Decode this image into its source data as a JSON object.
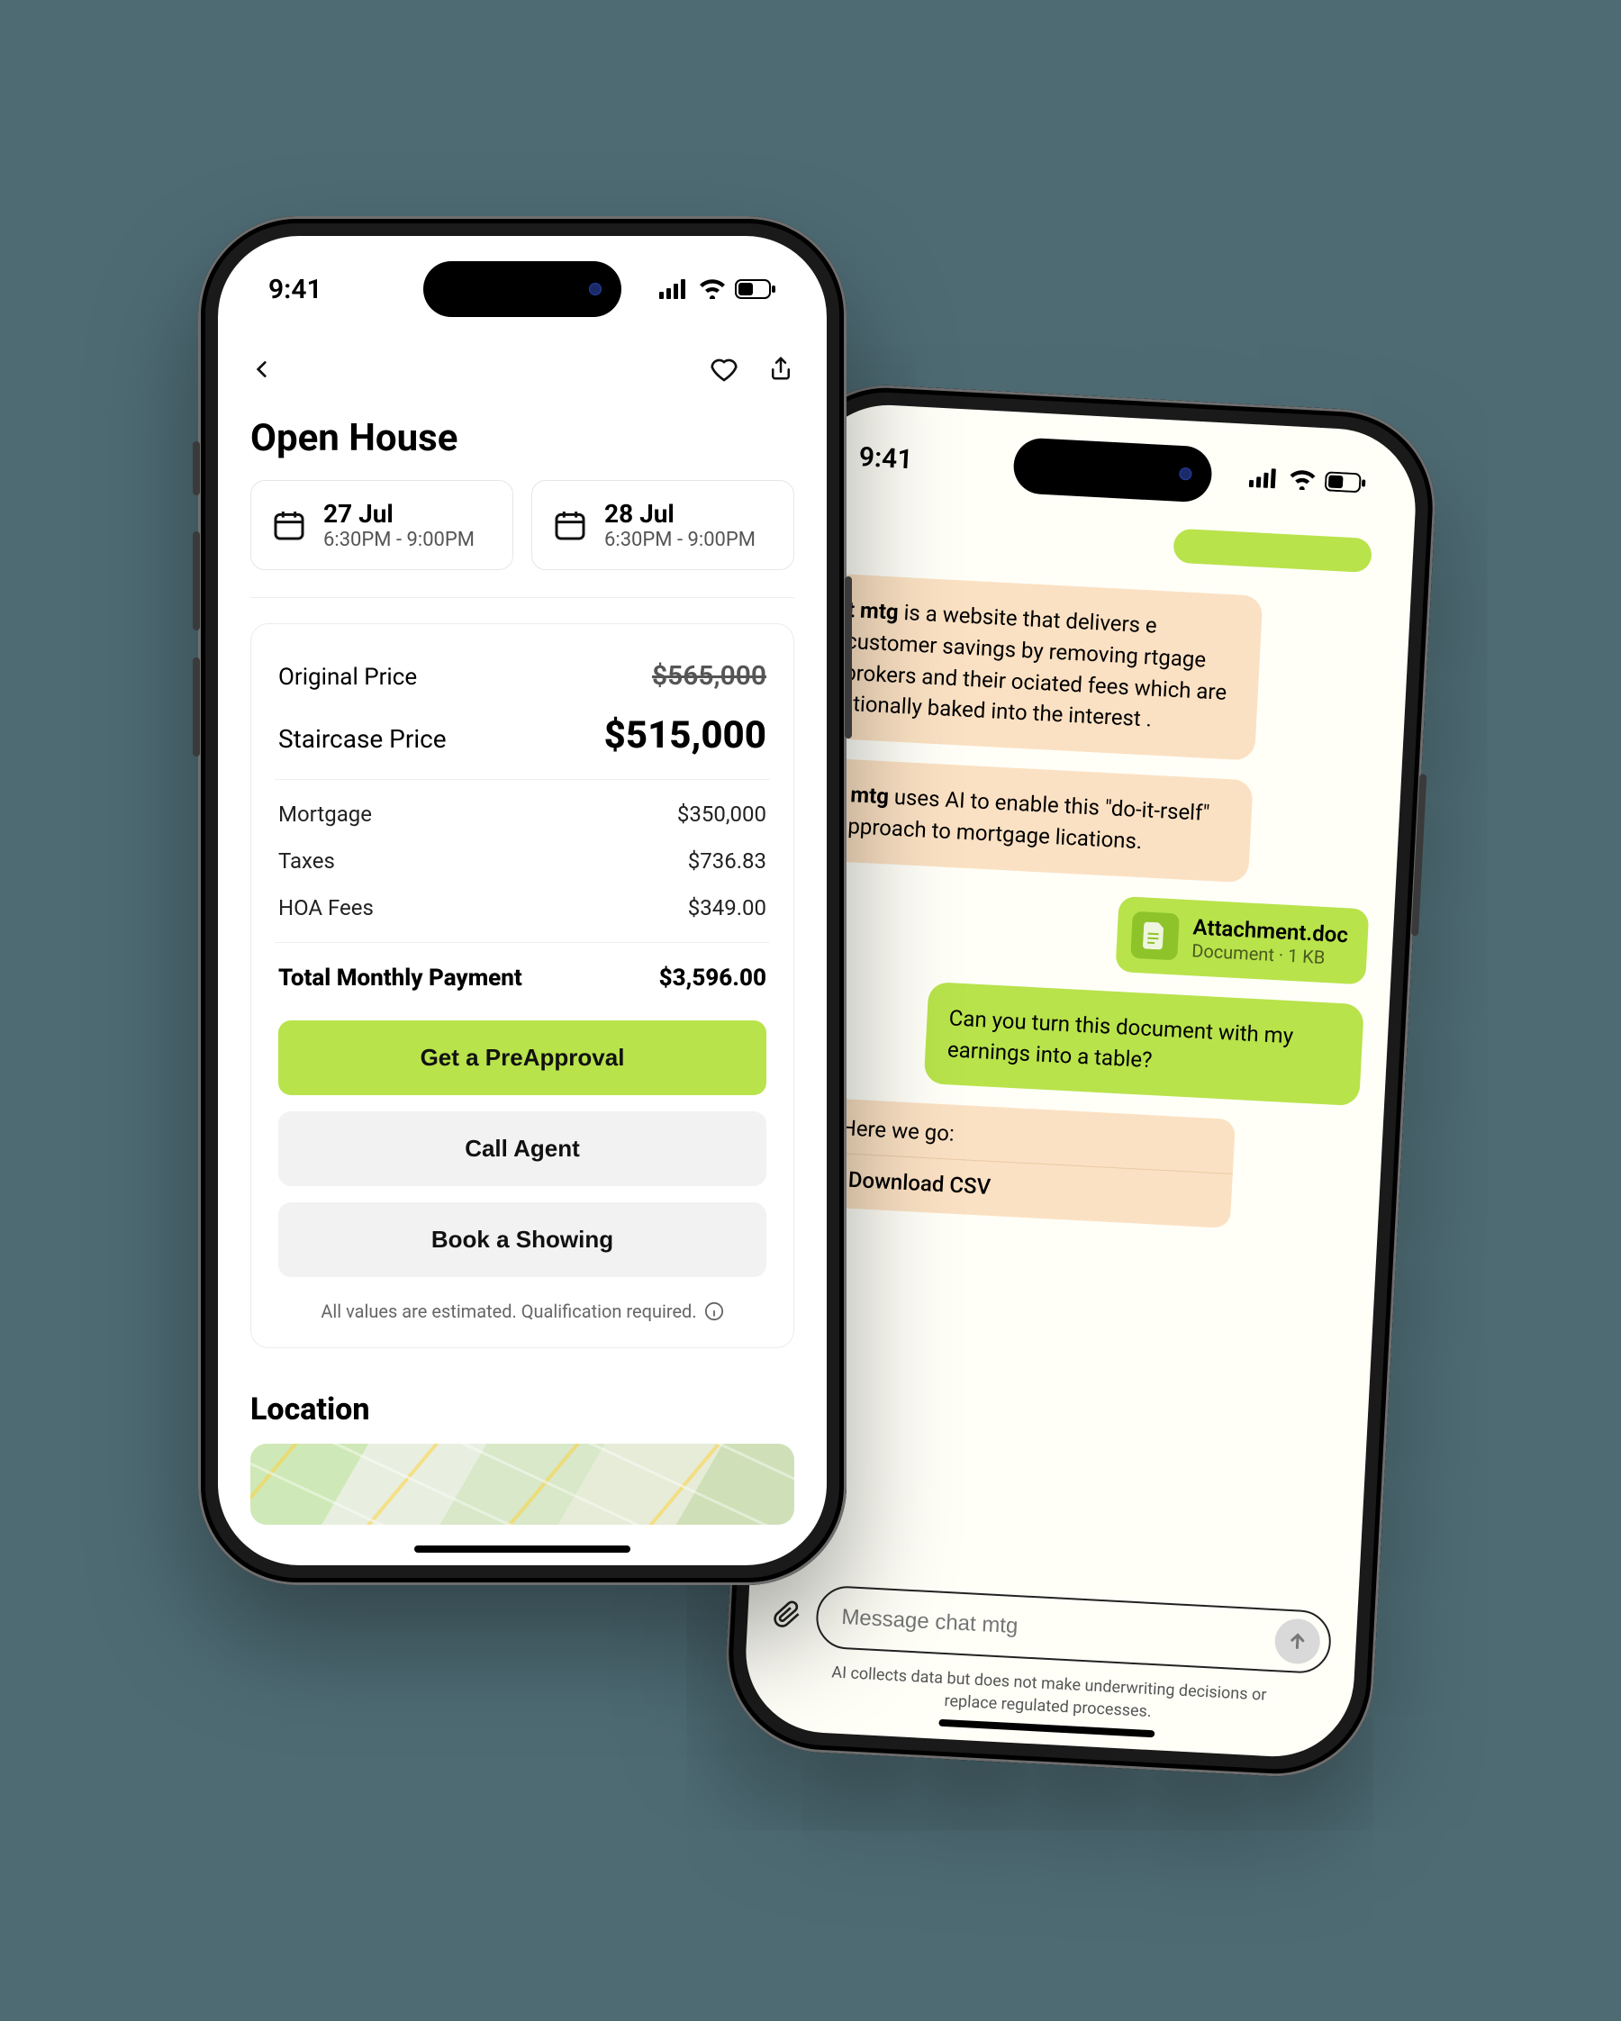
{
  "status": {
    "time": "9:41"
  },
  "phone1": {
    "title": "Open House",
    "dates": [
      {
        "date": "27 Jul",
        "time": "6:30PM - 9:00PM"
      },
      {
        "date": "28 Jul",
        "time": "6:30PM - 9:00PM"
      }
    ],
    "price": {
      "original_label": "Original Price",
      "original_value": "$565,000",
      "staircase_label": "Staircase Price",
      "staircase_value": "$515,000",
      "mortgage_label": "Mortgage",
      "mortgage_value": "$350,000",
      "taxes_label": "Taxes",
      "taxes_value": "$736.83",
      "hoa_label": "HOA Fees",
      "hoa_value": "$349.00",
      "total_label": "Total Monthly Payment",
      "total_value": "$3,596.00"
    },
    "actions": {
      "preapproval": "Get a PreApproval",
      "call": "Call Agent",
      "book": "Book a Showing"
    },
    "disclaimer": "All values are estimated. Qualification required.",
    "location_title": "Location"
  },
  "phone2": {
    "messages": {
      "m1_a": "t mtg",
      "m1_b": " is a website that delivers e customer savings by removing rtgage brokers and their ociated fees which are litionally baked into the interest .",
      "m2_a": "t mtg",
      "m2_b": " uses AI to enable this \"do-it-rself\" approach to mortgage lications.",
      "attach_name": "Attachment.doc",
      "attach_meta": "Document · 1 KB",
      "me1": "Can you turn this document with my earnings into a table?",
      "reply_head": "e! Here we go:",
      "download": "Download CSV"
    },
    "input_placeholder": "Message chat mtg",
    "fineprint": "AI collects data but does not make underwriting decisions or replace regulated processes."
  }
}
